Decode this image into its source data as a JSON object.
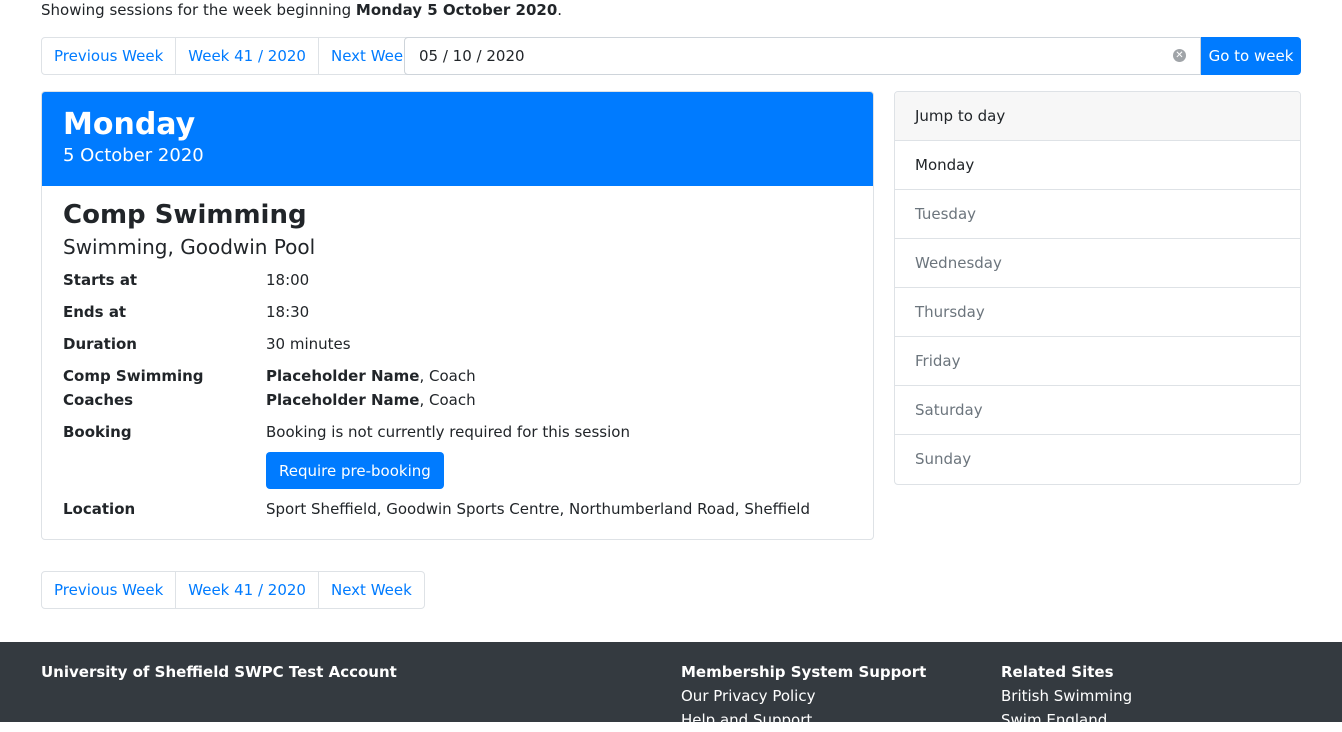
{
  "intro": {
    "prefix": "Showing sessions for the week beginning ",
    "week_bold": "Monday 5 October 2020",
    "suffix": "."
  },
  "pager": {
    "prev": "Previous Week",
    "current": "Week 41 / 2020",
    "next": "Next Week"
  },
  "date_picker": {
    "value": "05 / 10 / 2020",
    "clear_icon": "clear-icon",
    "go_label": "Go to week"
  },
  "day": {
    "name": "Monday",
    "date": "5 October 2020",
    "session": {
      "title": "Comp Swimming",
      "subtitle": "Swimming, Goodwin Pool",
      "starts_label": "Starts at",
      "starts": "18:00",
      "ends_label": "Ends at",
      "ends": "18:30",
      "duration_label": "Duration",
      "duration": "30 minutes",
      "coaches_label": "Comp Swimming Coaches",
      "coaches": [
        {
          "name": "Placeholder Name",
          "role": ", Coach"
        },
        {
          "name": "Placeholder Name",
          "role": ", Coach"
        }
      ],
      "booking_label": "Booking",
      "booking_text": "Booking is not currently required for this session",
      "prebook_button": "Require pre-booking",
      "location_label": "Location",
      "location": "Sport Sheffield, Goodwin Sports Centre, Northumberland Road, Sheffield"
    }
  },
  "jump": {
    "title": "Jump to day",
    "days": [
      "Monday",
      "Tuesday",
      "Wednesday",
      "Thursday",
      "Friday",
      "Saturday",
      "Sunday"
    ]
  },
  "footer": {
    "org": "University of Sheffield SWPC Test Account",
    "support_heading": "Membership System Support",
    "support_links": [
      "Our Privacy Policy",
      "Help and Support"
    ],
    "related_heading": "Related Sites",
    "related_links": [
      "British Swimming",
      "Swim England"
    ]
  }
}
